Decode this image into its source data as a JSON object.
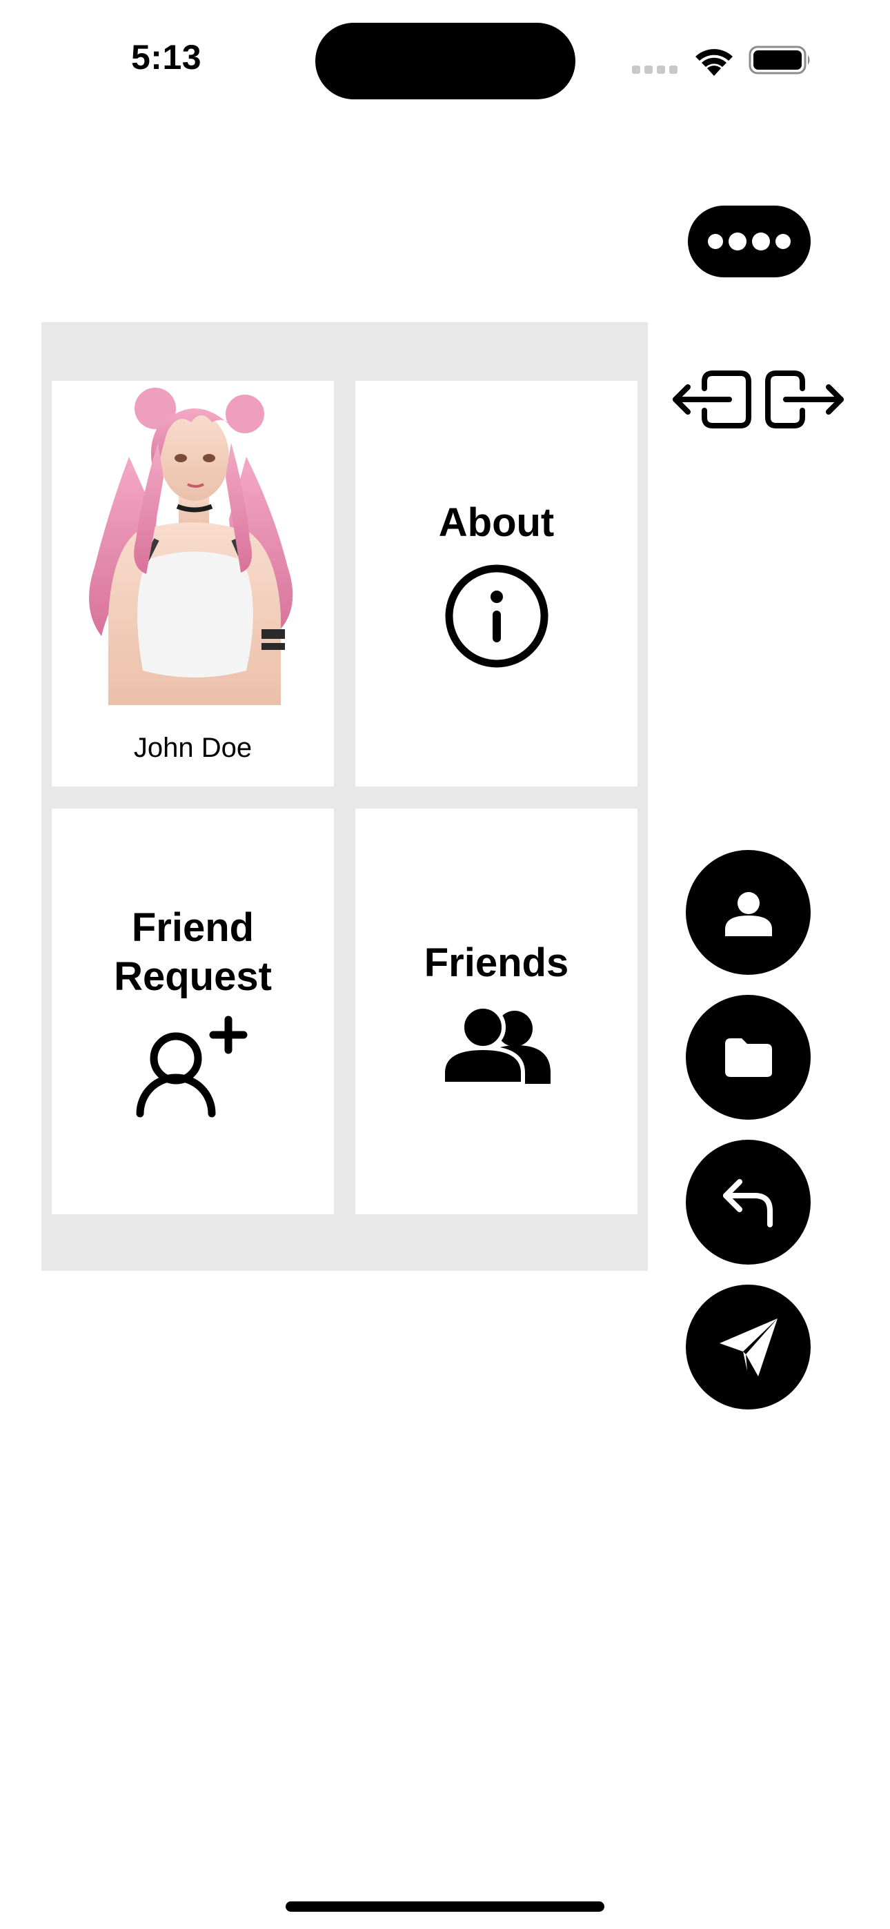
{
  "status_bar": {
    "time": "5:13"
  },
  "profile": {
    "name": "John Doe"
  },
  "tiles": {
    "about": "About",
    "friend_request": "Friend Request",
    "friends": "Friends"
  },
  "icons": {
    "more": "ellipsis-icon",
    "swap": "login-logout-arrows-icon",
    "about": "info-circle-icon",
    "friend_request": "person-add-icon",
    "friends": "people-icon",
    "fab_profile": "person-icon",
    "fab_folder": "folder-icon",
    "fab_reply": "reply-arrow-icon",
    "fab_send": "paper-plane-icon"
  },
  "colors": {
    "panel_background": "#e8e8e8",
    "tile_background": "#ffffff",
    "button_background": "#000000"
  }
}
